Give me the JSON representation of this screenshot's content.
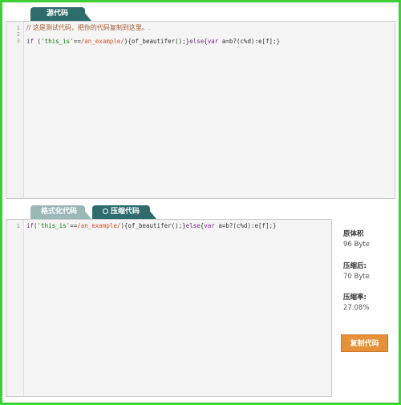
{
  "tabs": {
    "source": "源代码",
    "format": "格式化代码",
    "compress": "压缩代码"
  },
  "source_editor": {
    "line_numbers": [
      "1",
      "2",
      "3"
    ],
    "line1_comment": "// 这是测试代码，把你的代码复制到这里。.",
    "line3": {
      "if": "if",
      "open": " (",
      "str": "'this_is'",
      "eq": "==",
      "regex": "/an_example/",
      "close": ")",
      "brace_call": "{of_beautifer();}",
      "else": "else",
      "brace_open": "{",
      "var": "var",
      "rest": " a=b?(c%d):e[f];}"
    }
  },
  "output_editor": {
    "line_numbers": [
      "1"
    ],
    "line1": {
      "if": "if",
      "open": "(",
      "str": "'this_is'",
      "eq": "==",
      "regex": "/an_example/",
      "close": ")",
      "brace_call": "{of_beautifer();}",
      "else": "else",
      "brace_open": "{",
      "var": "var",
      "rest": " a=b?(c%d):e[f];}"
    }
  },
  "stats": {
    "original_label": "原体积",
    "original_value": "96 Byte",
    "compressed_label": "压缩后:",
    "compressed_value": "70 Byte",
    "ratio_label": "压缩率:",
    "ratio_value": "27.08%"
  },
  "copy_button": "复制代码",
  "colors": {
    "tab_active": "#2e6b6b",
    "tab_inactive": "#9bb8b8",
    "frame_border": "#3fcf37",
    "button": "#e69137"
  }
}
